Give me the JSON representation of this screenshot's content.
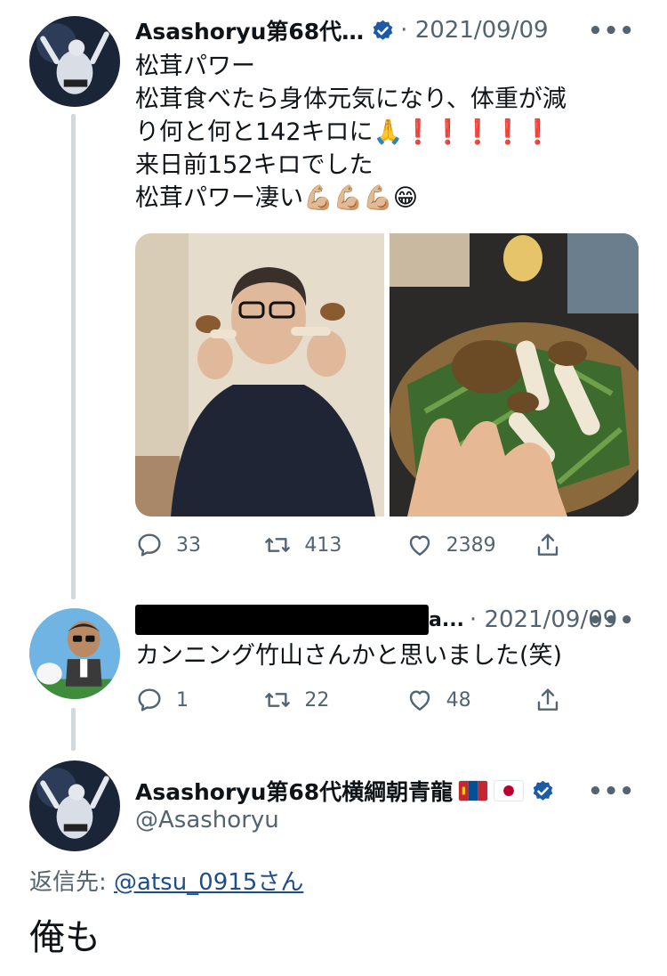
{
  "tweet1": {
    "name": "Asashoryu第68代…",
    "date": "· 2021/09/09",
    "text_lines": [
      "松茸パワー",
      "松茸食べたら身体元気になり、体重が減",
      "り何と何と142キロに🙏❗❗❗❗❗",
      "来日前152キロでした",
      "松茸パワー凄い💪🏼💪🏼💪🏼😁"
    ],
    "stats": {
      "replies": "33",
      "retweets": "413",
      "likes": "2389"
    }
  },
  "tweet2": {
    "name_suffix": "a...",
    "date": "· 2021/09/09",
    "text": "カンニング竹山さんかと思いました(笑)",
    "stats": {
      "replies": "1",
      "retweets": "22",
      "likes": "48"
    }
  },
  "tweet3": {
    "name": "Asashoryu第68代横綱朝青龍",
    "handle": "@Asashoryu",
    "reply_prefix": "返信先: ",
    "reply_target": "@atsu_0915さん",
    "text": "俺も"
  },
  "colors": {
    "verified": "#1d5ba8",
    "muted": "#536471",
    "text": "#0f1419",
    "line": "#cfd9de"
  }
}
